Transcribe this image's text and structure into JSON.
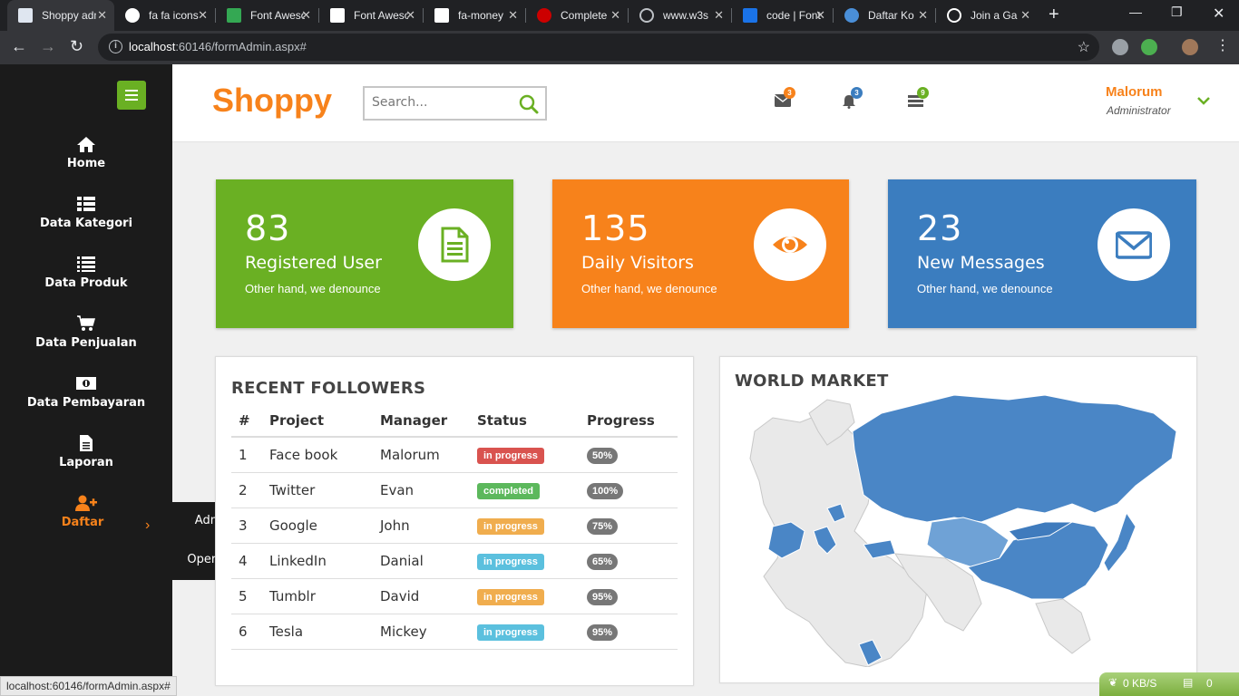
{
  "browser": {
    "tabs": [
      {
        "title": "Shoppy admin"
      },
      {
        "title": "fa fa icons"
      },
      {
        "title": "Font Awesome"
      },
      {
        "title": "Font Awesome"
      },
      {
        "title": "fa-money"
      },
      {
        "title": "Complete"
      },
      {
        "title": "www.w3s"
      },
      {
        "title": "code | Font"
      },
      {
        "title": "Daftar Ko"
      },
      {
        "title": "Join a Ga"
      }
    ],
    "url_host": "localhost",
    "url_rest": ":60146/formAdmin.aspx#",
    "status_url": "localhost:60146/formAdmin.aspx#"
  },
  "sidebar": {
    "items": [
      {
        "label": "Home",
        "icon": "home-icon"
      },
      {
        "label": "Data Kategori",
        "icon": "list-icon"
      },
      {
        "label": "Data Produk",
        "icon": "list-icon"
      },
      {
        "label": "Data Penjualan",
        "icon": "cart-icon"
      },
      {
        "label": "Data Pembayaran",
        "icon": "money-icon"
      },
      {
        "label": "Laporan",
        "icon": "file-icon"
      },
      {
        "label": "Daftar",
        "icon": "user-plus-icon"
      }
    ],
    "submenu": [
      "Admin",
      "Operator"
    ]
  },
  "header": {
    "brand": "Shoppy",
    "search_placeholder": "Search...",
    "badges": {
      "messages": "3",
      "notifications": "3",
      "tasks": "9"
    },
    "user_name": "Malorum",
    "user_role": "Administrator"
  },
  "cards": [
    {
      "number": "83",
      "title": "Registered User",
      "subtitle": "Other hand, we denounce",
      "color": "#6ab023"
    },
    {
      "number": "135",
      "title": "Daily Visitors",
      "subtitle": "Other hand, we denounce",
      "color": "#f7821b"
    },
    {
      "number": "23",
      "title": "New Messages",
      "subtitle": "Other hand, we denounce",
      "color": "#3b7dbf"
    }
  ],
  "followers": {
    "title": "RECENT FOLLOWERS",
    "columns": [
      "#",
      "Project",
      "Manager",
      "Status",
      "Progress"
    ],
    "rows": [
      {
        "no": "1",
        "project": "Face book",
        "manager": "Malorum",
        "status": "in progress",
        "status_color": "#d9534f",
        "progress": "50%"
      },
      {
        "no": "2",
        "project": "Twitter",
        "manager": "Evan",
        "status": "completed",
        "status_color": "#5cb85c",
        "progress": "100%"
      },
      {
        "no": "3",
        "project": "Google",
        "manager": "John",
        "status": "in progress",
        "status_color": "#f0ad4e",
        "progress": "75%"
      },
      {
        "no": "4",
        "project": "LinkedIn",
        "manager": "Danial",
        "status": "in progress",
        "status_color": "#5bc0de",
        "progress": "65%"
      },
      {
        "no": "5",
        "project": "Tumblr",
        "manager": "David",
        "status": "in progress",
        "status_color": "#f0ad4e",
        "progress": "95%"
      },
      {
        "no": "6",
        "project": "Tesla",
        "manager": "Mickey",
        "status": "in progress",
        "status_color": "#5bc0de",
        "progress": "95%"
      }
    ]
  },
  "world_market": {
    "title": "WORLD MARKET"
  },
  "tray": {
    "speed": "0 KB/S",
    "count": "0"
  }
}
